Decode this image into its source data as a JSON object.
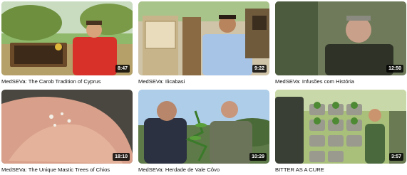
{
  "videos": [
    {
      "title": "MedSEVa: The Carob Tradition of Cyprus",
      "duration": "8:47"
    },
    {
      "title": "MedSEVa: Ilicabasi",
      "duration": "9:22"
    },
    {
      "title": "MedSEVa: Infusões com História",
      "duration": "12:50"
    },
    {
      "title": "MedSEVa: The Unique Mastic Trees of Chios",
      "duration": "18:10"
    },
    {
      "title": "MedSEVa: Herdade de Vale Côvo",
      "duration": "10:29"
    },
    {
      "title": "BITTER AS A CURE",
      "duration": "3:57"
    }
  ],
  "colors": {
    "duration_badge_bg": "#000000",
    "title_text": "#0f0f0f",
    "page_bg": "#ffffff"
  }
}
